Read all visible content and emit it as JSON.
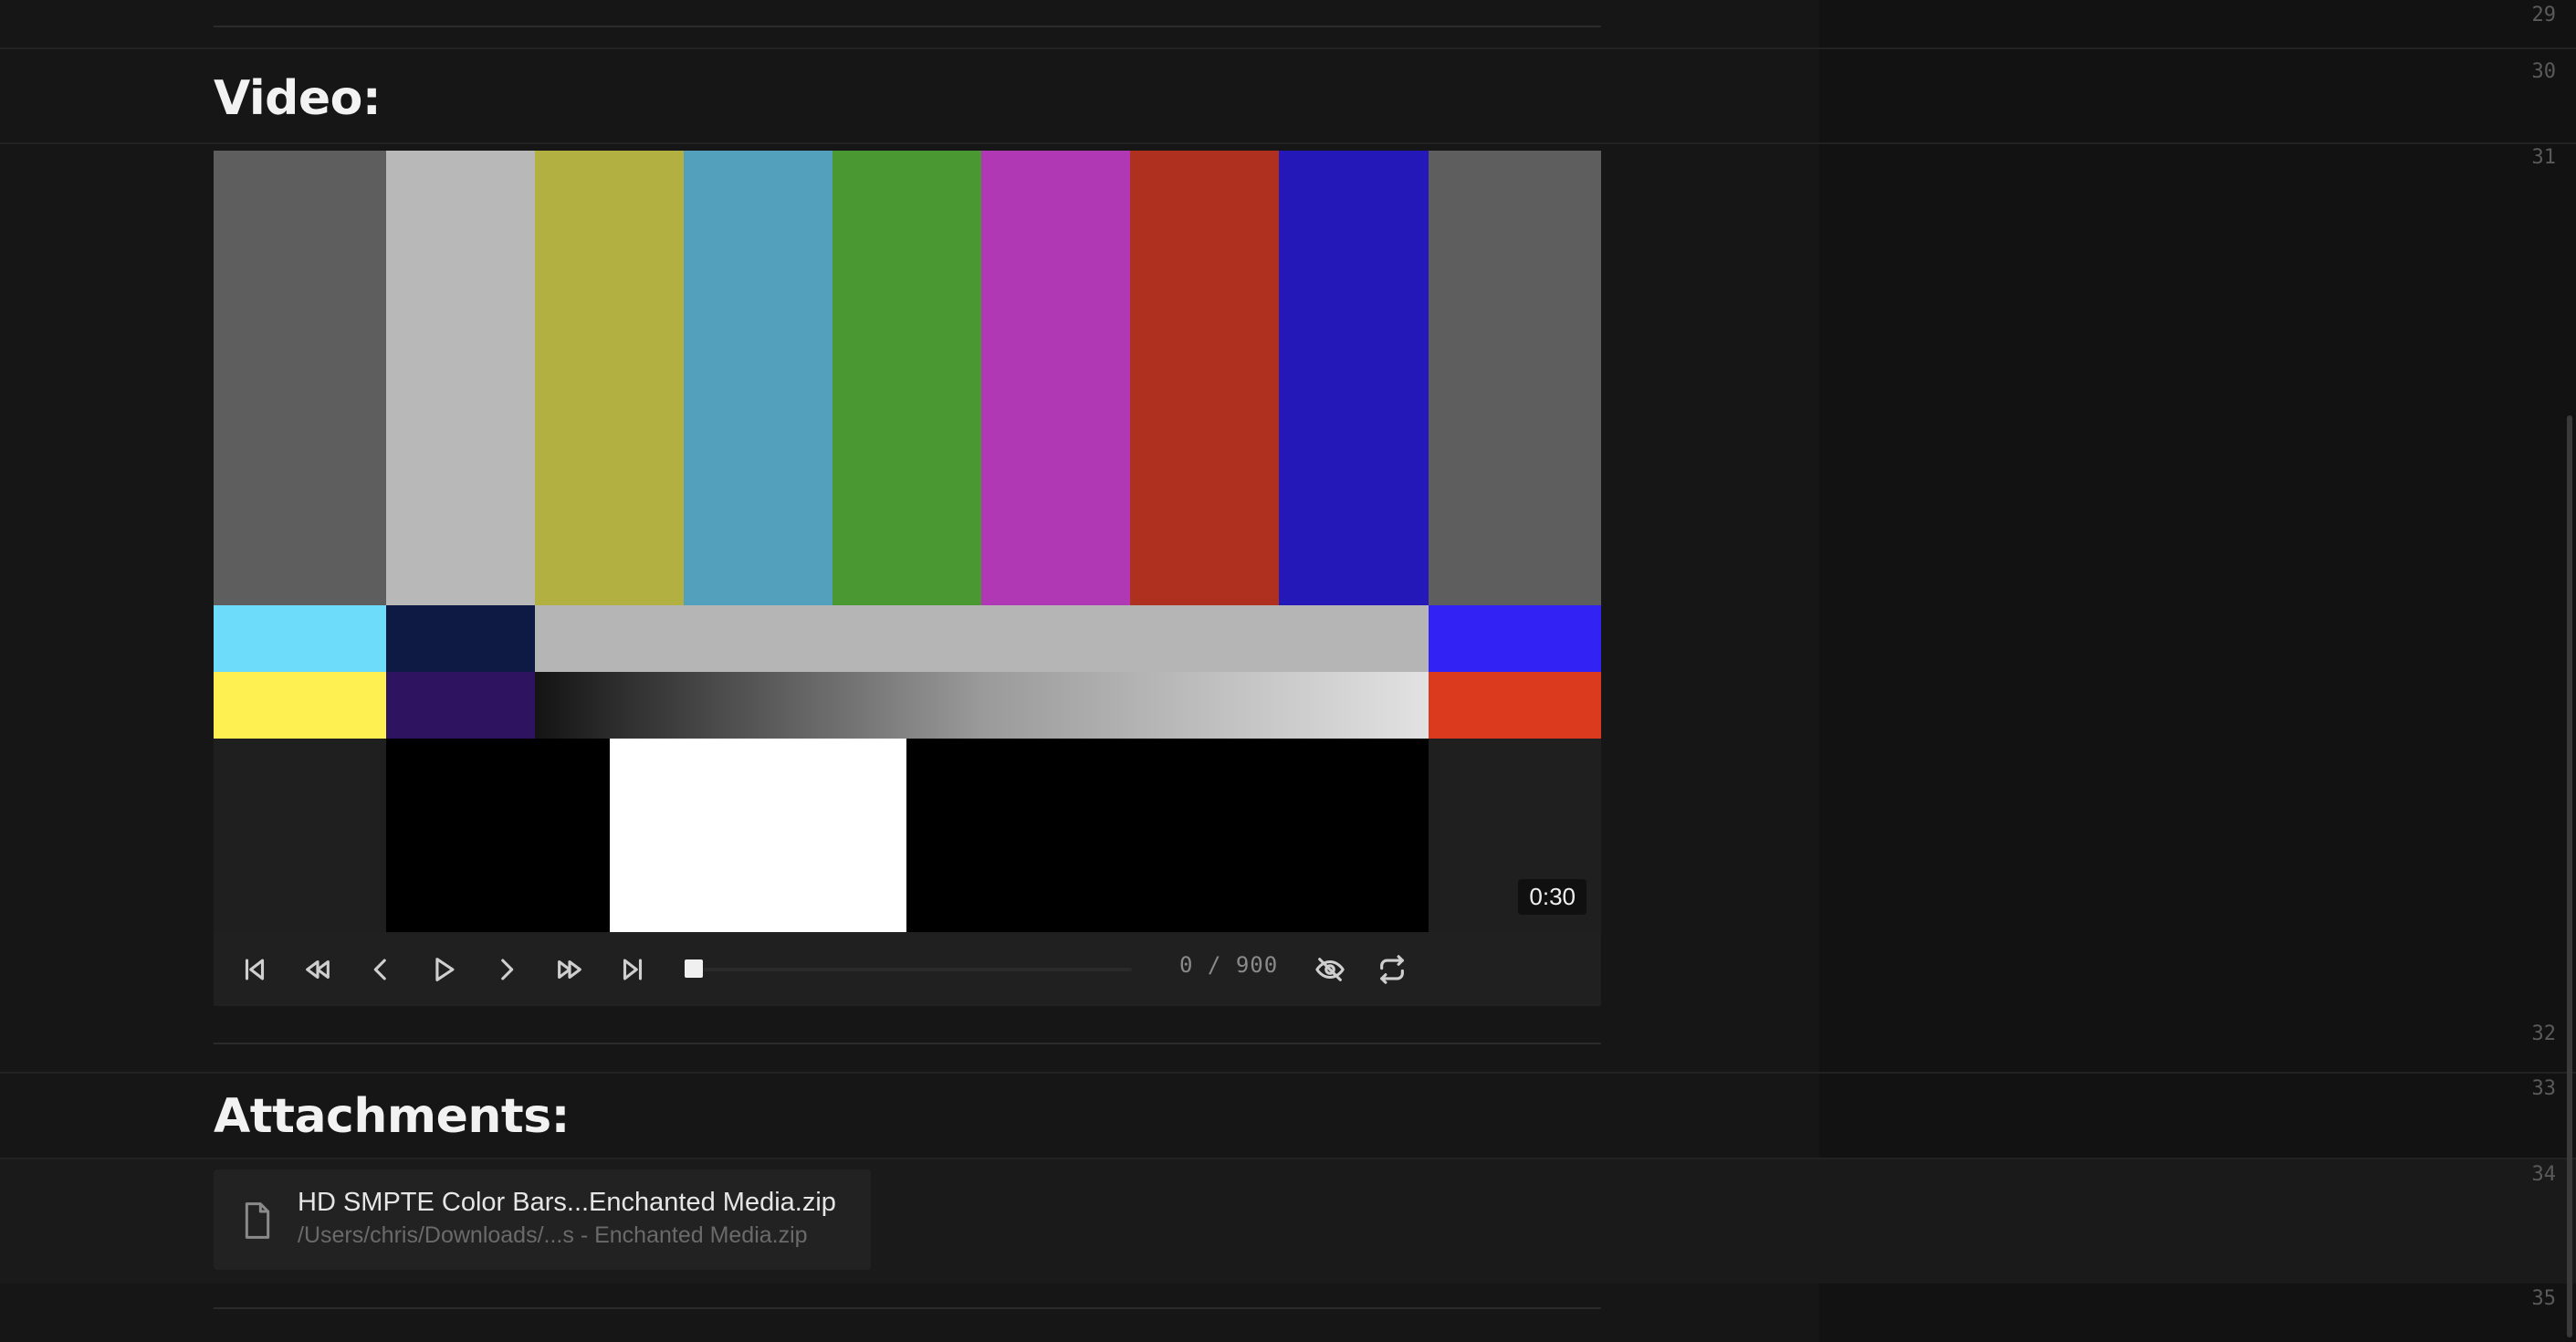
{
  "line_numbers": [
    "29",
    "30",
    "31",
    "32",
    "33",
    "34",
    "35"
  ],
  "headings": {
    "video": "Video:",
    "attachments": "Attachments:"
  },
  "video": {
    "duration": "0:30",
    "frame_current": "0",
    "frame_separator": "/",
    "frame_total": "900",
    "progress_fraction": 0,
    "controls": [
      {
        "name": "skip-to-start-icon"
      },
      {
        "name": "rewind-icon"
      },
      {
        "name": "step-back-icon"
      },
      {
        "name": "play-icon"
      },
      {
        "name": "step-forward-icon"
      },
      {
        "name": "fast-forward-icon"
      },
      {
        "name": "skip-to-end-icon"
      }
    ],
    "right_controls": [
      {
        "name": "eye-slash-icon"
      },
      {
        "name": "loop-icon"
      }
    ],
    "marker_color": "#a07ff0",
    "bar_colors": {
      "top": [
        "#5e5e5e",
        "#b8b8b8",
        "#b2b040",
        "#52a0bc",
        "#4a9832",
        "#b038b4",
        "#b03020",
        "#2418b8",
        "#5e5e5e"
      ],
      "mid_left": "#6cdcfa",
      "mid_left2": "#0e1a44",
      "mid_center": "#b5b5b5",
      "mid_right": "#3322f4",
      "low_left": "#fdf050",
      "low_left2": "#2e1460",
      "low_right": "#dc3a1e"
    }
  },
  "attachment": {
    "name": "HD SMPTE Color Bars...Enchanted Media.zip",
    "path": "/Users/chris/Downloads/...s - Enchanted Media.zip",
    "icon": "file-icon"
  }
}
